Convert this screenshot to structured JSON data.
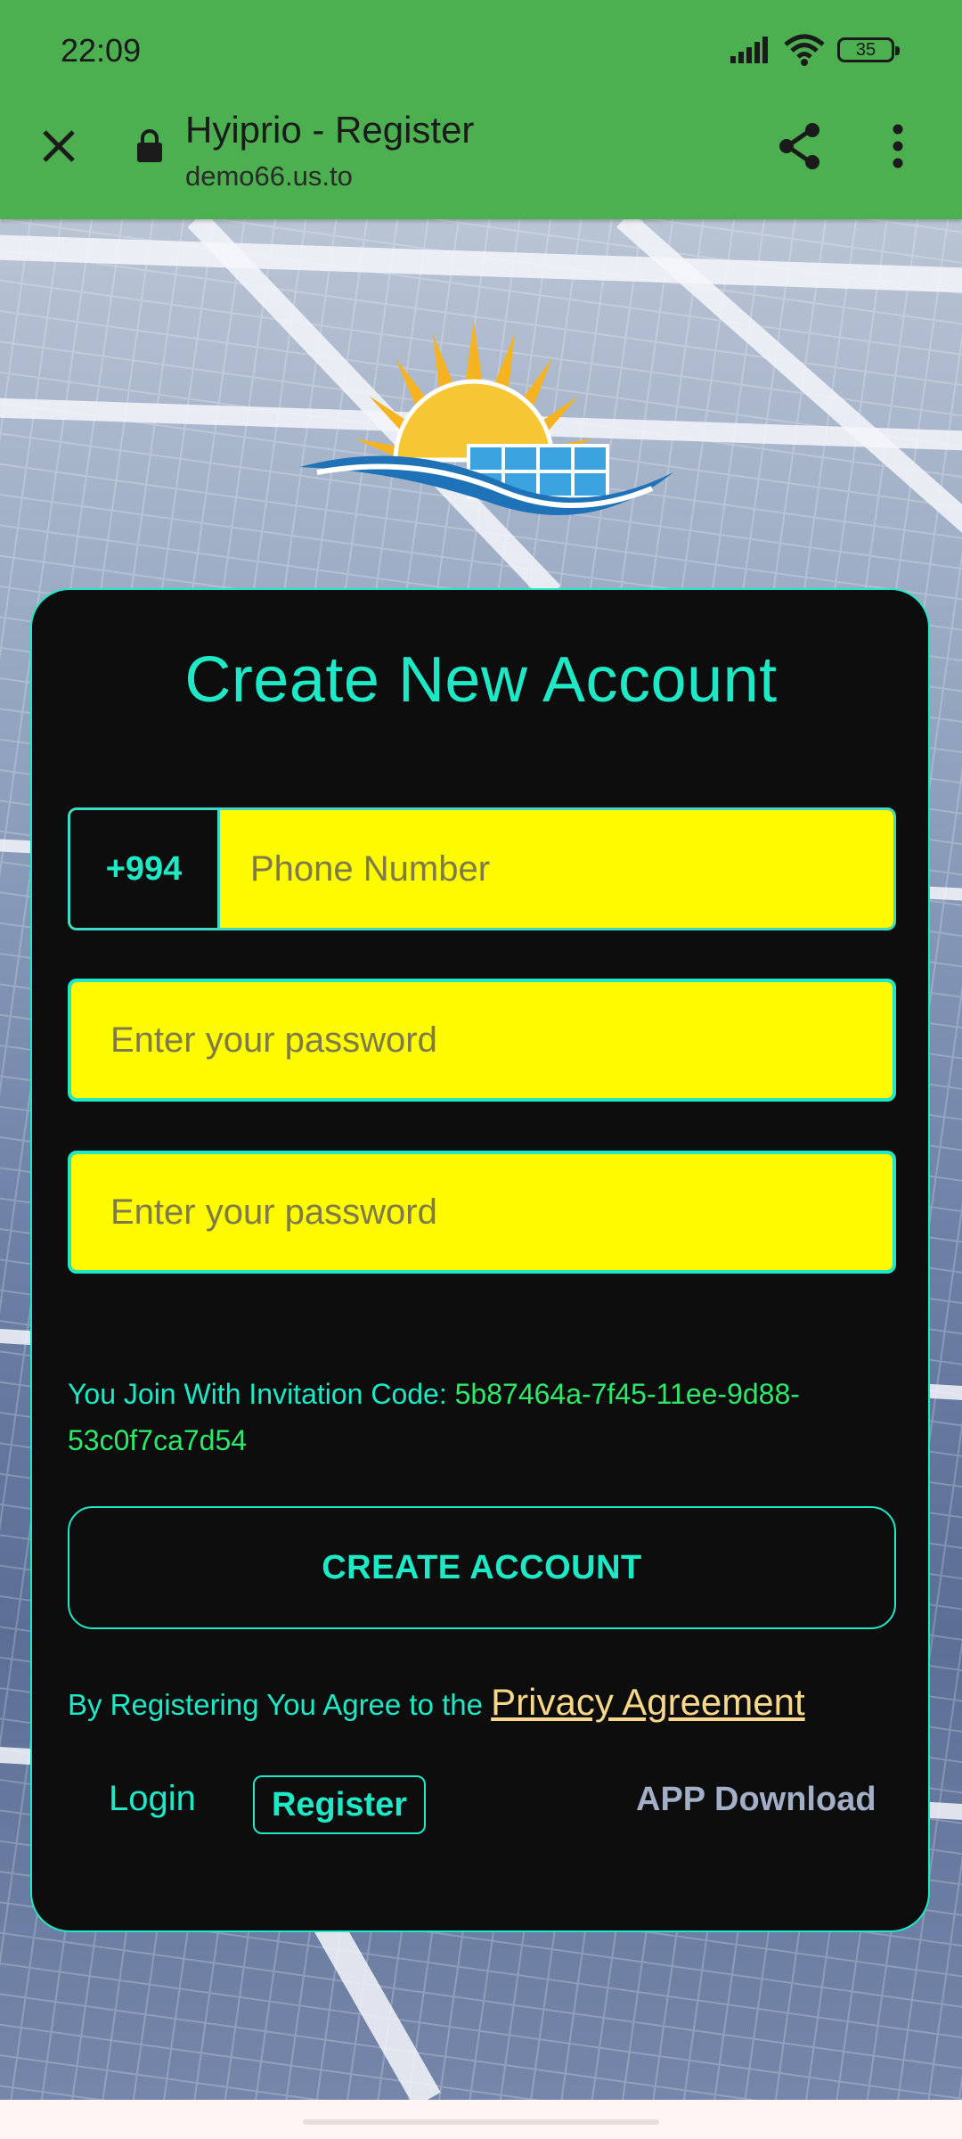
{
  "status_bar": {
    "time": "22:09",
    "battery_level": "35",
    "icons": [
      "signal-icon",
      "wifi-icon",
      "battery-icon"
    ]
  },
  "browser": {
    "title": "Hyiprio - Register",
    "url": "demo66.us.to",
    "icons": [
      "close-icon",
      "lock-icon",
      "share-icon",
      "more-vert-icon"
    ],
    "toolbar_color": "#4caf50"
  },
  "form": {
    "heading": "Create New Account",
    "country_code": "+994",
    "phone_placeholder": "Phone Number",
    "password_placeholder": "Enter your password",
    "confirm_password_placeholder": "Enter your password",
    "invite_label": "You Join With Invitation Code:",
    "invite_code": "5b87464a-7f45-11ee-9d88-53c0f7ca7d54",
    "submit_label": "CREATE ACCOUNT",
    "agree_text": "By Registering You Agree to the",
    "privacy_link": "Privacy Agreement"
  },
  "footer_nav": {
    "login": "Login",
    "register": "Register",
    "app_download": "APP Download"
  },
  "colors": {
    "accent": "#1de9c6",
    "input_bg": "#fefa00",
    "card_bg": "#0d0d0d",
    "invite_code": "#2ee86a",
    "privacy_link": "#f7d88a"
  }
}
